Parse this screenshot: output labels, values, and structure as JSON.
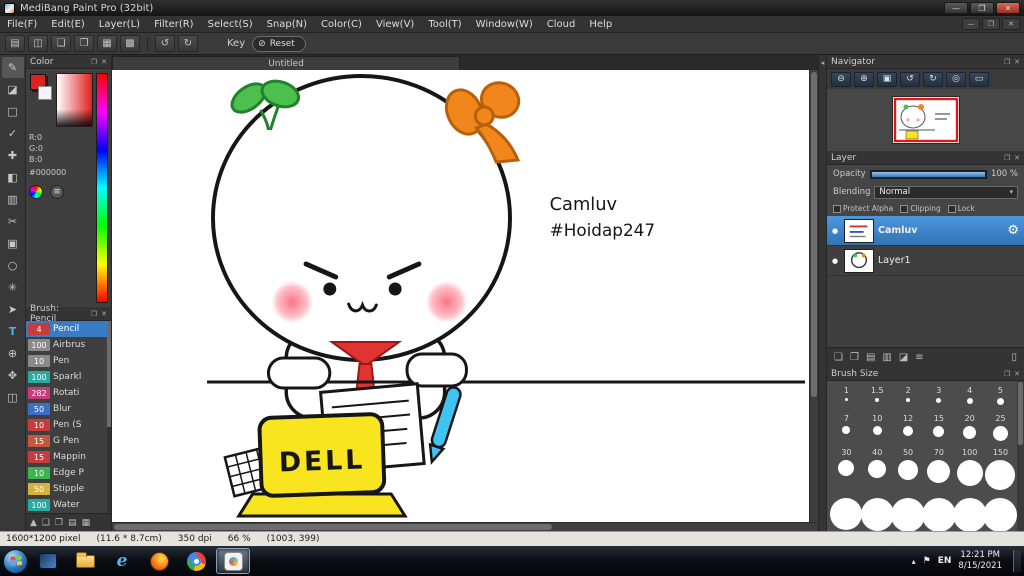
{
  "window": {
    "title": "MediBang Paint Pro (32bit)",
    "minimize": "—",
    "maximize": "❐",
    "close": "✕"
  },
  "menu": {
    "items": [
      "File(F)",
      "Edit(E)",
      "Layer(L)",
      "Filter(R)",
      "Select(S)",
      "Snap(N)",
      "Color(C)",
      "View(V)",
      "Tool(T)",
      "Window(W)",
      "Cloud",
      "Help"
    ]
  },
  "toolbar": {
    "icons": [
      "▤",
      "◫",
      "❏",
      "❐",
      "▦",
      "▩"
    ],
    "undo": "↺",
    "redo": "↻",
    "key_label": "Key",
    "reset_icon": "⊘",
    "reset_label": "Reset"
  },
  "tools": [
    {
      "glyph": "✎"
    },
    {
      "glyph": "◪"
    },
    {
      "glyph": "□"
    },
    {
      "glyph": "✓"
    },
    {
      "glyph": "✚"
    },
    {
      "glyph": "◧"
    },
    {
      "glyph": "▥"
    },
    {
      "glyph": "✂"
    },
    {
      "glyph": "▣"
    },
    {
      "glyph": "○"
    },
    {
      "glyph": "✳"
    },
    {
      "glyph": "➤"
    },
    {
      "glyph": "T"
    },
    {
      "glyph": "⊕"
    },
    {
      "glyph": "✥"
    },
    {
      "glyph": "◫"
    }
  ],
  "workspace": {
    "collapse_arrow": "◂"
  },
  "color_panel": {
    "title": "Color",
    "r_label": "R:0",
    "g_label": "G:0",
    "b_label": "B:0",
    "hex": "#000000",
    "sliders_icon": "≡",
    "float_icon": "❐",
    "close_icon": "✕"
  },
  "brush_panel": {
    "title": "Brush: Pencil",
    "float_icon": "❐",
    "close_icon": "✕",
    "brushes": [
      {
        "size": "4",
        "name": "Pencil",
        "color": "#c43c3c"
      },
      {
        "size": "100",
        "name": "Airbrus",
        "color": "#8a8a8a"
      },
      {
        "size": "10",
        "name": "Pen",
        "color": "#8a8a8a"
      },
      {
        "size": "100",
        "name": "Sparkl",
        "color": "#2aa9a0"
      },
      {
        "size": "282",
        "name": "Rotati",
        "color": "#c43c7a"
      },
      {
        "size": "50",
        "name": "Blur",
        "color": "#3c6fc4"
      },
      {
        "size": "10",
        "name": "Pen (S",
        "color": "#c43c3c"
      },
      {
        "size": "15",
        "name": "G Pen",
        "color": "#c4583c"
      },
      {
        "size": "15",
        "name": "Mappin",
        "color": "#c43c3c"
      },
      {
        "size": "10",
        "name": "Edge P",
        "color": "#3cb450"
      },
      {
        "size": "50",
        "name": "Stipple",
        "color": "#d4b23c"
      },
      {
        "size": "100",
        "name": "Water",
        "color": "#2aa9a0"
      }
    ],
    "footer_icons": [
      "▲",
      "❏",
      "❐",
      "▤",
      "▦"
    ]
  },
  "canvas": {
    "tab": "Untitled",
    "annotation1": "Camluv",
    "annotation2": "#Hoidap247",
    "laptop_text": "DELL"
  },
  "navigator": {
    "title": "Navigator",
    "float_icon": "❐",
    "close_icon": "✕",
    "buttons": [
      "⊖",
      "⊕",
      "▣",
      "↺",
      "↻",
      "◎",
      "▭"
    ]
  },
  "layer_panel": {
    "title": "Layer",
    "float_icon": "❐",
    "close_icon": "✕",
    "opacity_label": "Opacity",
    "opacity_value": "100 %",
    "blending_label": "Blending",
    "blending_value": "Normal",
    "dropdown_arrow": "▾",
    "checkbox1": "Protect Alpha",
    "checkbox2": "Clipping",
    "checkbox3": "Lock",
    "eye": "●",
    "gear": "⚙",
    "layers": [
      {
        "name": "Camluv"
      },
      {
        "name": "Layer1"
      }
    ],
    "footer_icons": [
      "❏",
      "❐",
      "▤",
      "▥",
      "◪",
      "≡",
      "▯"
    ]
  },
  "brush_size_panel": {
    "title": "Brush Size",
    "float_icon": "❐",
    "close_icon": "✕",
    "row1": [
      "1",
      "1.5",
      "2",
      "3",
      "4",
      "5"
    ],
    "row2": [
      "7",
      "10",
      "12",
      "15",
      "20",
      "25"
    ],
    "row3": [
      "30",
      "40",
      "50",
      "70",
      "100",
      "150"
    ]
  },
  "status_bar": {
    "size": "1600*1200 pixel",
    "dimensions": "(11.6 * 8.7cm)",
    "dpi": "350 dpi",
    "zoom": "66 %",
    "coords": "(1003, 399)"
  },
  "taskbar": {
    "tray_arrow": "▴",
    "flag": "⚑",
    "language": "EN",
    "time": "12:21 PM",
    "date": "8/15/2021"
  }
}
